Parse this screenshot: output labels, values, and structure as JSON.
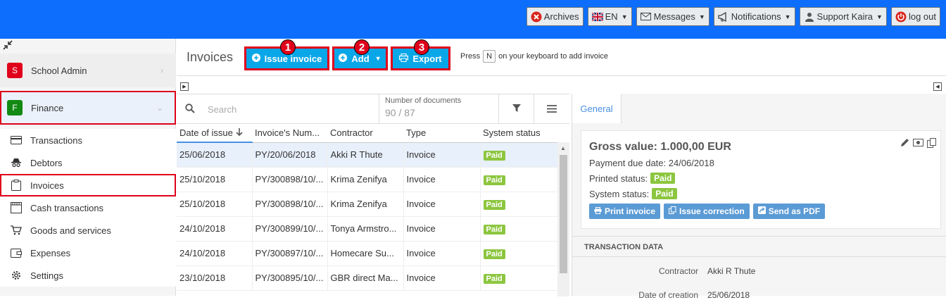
{
  "topbar": {
    "archives": "Archives",
    "language": "EN",
    "messages": "Messages",
    "notifications": "Notifications",
    "user": "Support Kaira",
    "logout": "log out"
  },
  "sidebar": {
    "modules": [
      {
        "letter": "S",
        "label": "School Admin",
        "color": "#e0001b"
      },
      {
        "letter": "F",
        "label": "Finance",
        "color": "#138a13"
      }
    ],
    "items": [
      {
        "label": "Transactions",
        "icon": "credit-card-icon"
      },
      {
        "label": "Debtors",
        "icon": "spy-icon"
      },
      {
        "label": "Invoices",
        "icon": "clipboard-icon"
      },
      {
        "label": "Cash transactions",
        "icon": "cash-register-icon"
      },
      {
        "label": "Goods and services",
        "icon": "cart-icon"
      },
      {
        "label": "Expenses",
        "icon": "wallet-icon"
      },
      {
        "label": "Settings",
        "icon": "gear-icon"
      }
    ]
  },
  "toolbar": {
    "title": "Invoices",
    "issue_invoice": "Issue invoice",
    "add": "Add",
    "export": "Export",
    "badges": [
      "1",
      "2",
      "3"
    ],
    "hint_press": "Press",
    "hint_key": "N",
    "hint_rest": "on your keyboard to add invoice"
  },
  "list": {
    "search_placeholder": "Search",
    "doc_count_label": "Number of documents",
    "doc_count_value": "90 / 87",
    "columns": [
      "Date of issue",
      "Invoice's Num...",
      "Contractor",
      "Type",
      "System status"
    ],
    "rows": [
      {
        "date": "25/06/2018",
        "number": "PY/20/06/2018",
        "contractor": "Akki R Thute",
        "type": "Invoice",
        "status": "Paid"
      },
      {
        "date": "25/10/2018",
        "number": "PY/300898/10/...",
        "contractor": "Krima Zenifya",
        "type": "Invoice",
        "status": "Paid"
      },
      {
        "date": "25/10/2018",
        "number": "PY/300898/10/...",
        "contractor": "Krima Zenifya",
        "type": "Invoice",
        "status": "Paid"
      },
      {
        "date": "24/10/2018",
        "number": "PY/300899/10/...",
        "contractor": "Tonya Armstro...",
        "type": "Invoice",
        "status": "Paid"
      },
      {
        "date": "24/10/2018",
        "number": "PY/300897/10/...",
        "contractor": "Homecare Su...",
        "type": "Invoice",
        "status": "Paid"
      },
      {
        "date": "23/10/2018",
        "number": "PY/300895/10/...",
        "contractor": "GBR direct Ma...",
        "type": "Invoice",
        "status": "Paid"
      }
    ]
  },
  "detail": {
    "tab": "General",
    "gross": "Gross value: 1.000,00 EUR",
    "due": "Payment due date: 24/06/2018",
    "printed_label": "Printed status:",
    "printed_value": "Paid",
    "system_label": "System status:",
    "system_value": "Paid",
    "print_invoice": "Print invoice",
    "issue_correction": "Issue correction",
    "send_pdf": "Send as PDF",
    "section": "TRANSACTION DATA",
    "contractor_label": "Contractor",
    "contractor_value": "Akki R Thute",
    "creation_label": "Date of creation",
    "creation_value": "25/06/2018"
  },
  "colors": {
    "topbar": "#0d6efd",
    "accent": "#0aa7e8",
    "highlight": "#e0001b",
    "paid": "#8cc63f"
  }
}
